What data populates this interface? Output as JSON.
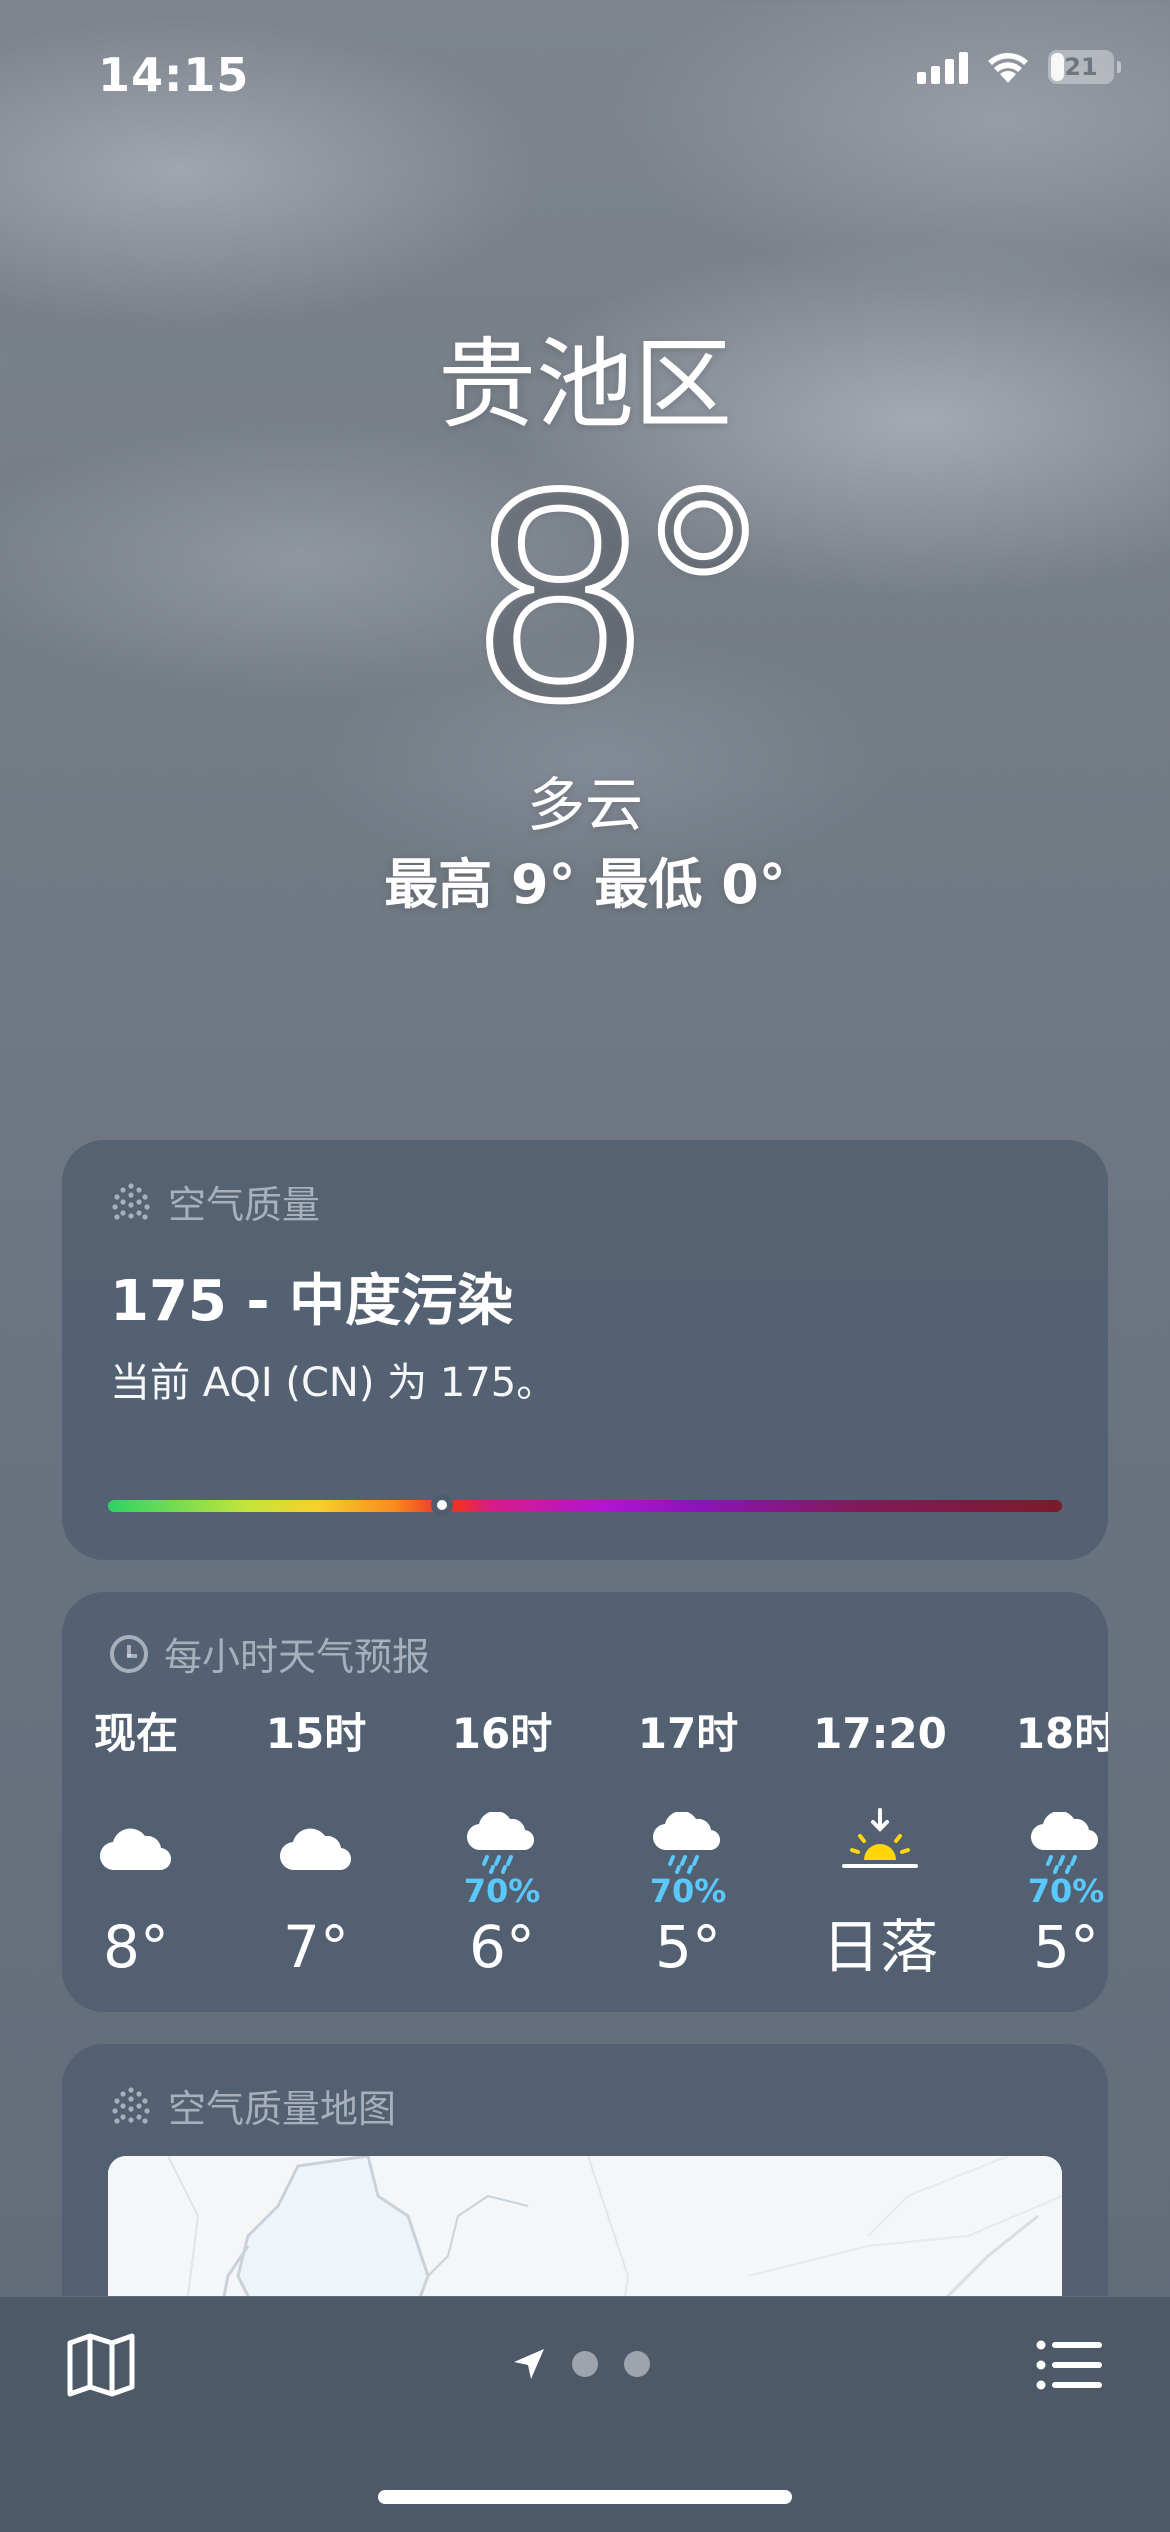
{
  "status_bar": {
    "time": "14:15",
    "battery": "21",
    "battery_level": 0.21
  },
  "hero": {
    "city": "贵池区",
    "temperature": "8°",
    "condition": "多云",
    "high_low": "最高 9°  最低 0°"
  },
  "aqi_card": {
    "header": "空气质量",
    "title": "175 - 中度污染",
    "description": "当前 AQI (CN) 为 175。",
    "marker_fraction": 0.35
  },
  "hourly_card": {
    "header": "每小时天气预报",
    "items": [
      {
        "time": "现在",
        "icon": "cloud-icon",
        "pop": "",
        "temp": "8°"
      },
      {
        "time": "15时",
        "icon": "cloud-icon",
        "pop": "",
        "temp": "7°"
      },
      {
        "time": "16时",
        "icon": "cloud-rain-icon",
        "pop": "70%",
        "temp": "6°"
      },
      {
        "time": "17时",
        "icon": "cloud-rain-icon",
        "pop": "70%",
        "temp": "5°"
      },
      {
        "time": "17:20",
        "icon": "sunset-icon",
        "pop": "",
        "temp": "日落"
      },
      {
        "time": "18时",
        "icon": "cloud-rain-icon",
        "pop": "70%",
        "temp": "5°"
      }
    ]
  },
  "map_card": {
    "header": "空气质量地图"
  },
  "bottom_bar": {
    "map_button": "map-icon",
    "location_indicator": "location-arrow-icon",
    "page_count": 2,
    "list_button": "list-icon"
  },
  "colors": {
    "precip": "#5ac8fa",
    "sun": "#ffd60a",
    "card_bg": "#4e5c6e"
  }
}
